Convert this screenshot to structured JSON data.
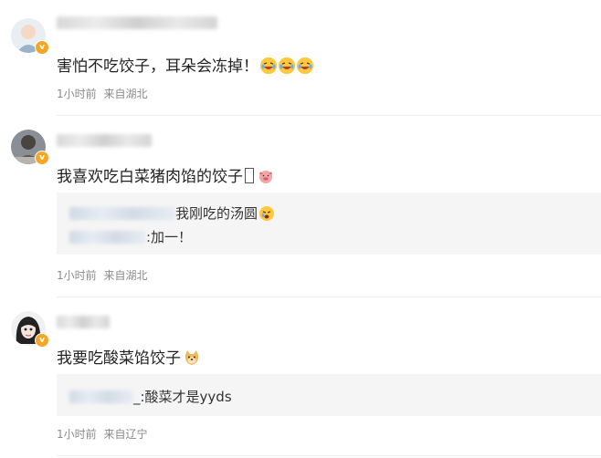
{
  "comments": [
    {
      "text": "害怕不吃饺子，耳朵会冻掉！",
      "emojis": [
        "laughing-tears-emoji",
        "laughing-tears-emoji",
        "laughing-tears-emoji"
      ],
      "time": "1小时前",
      "location": "来自湖北"
    },
    {
      "text": "我喜欢吃白菜猪肉馅的饺子",
      "emojis": [
        "box-glyph",
        "pig-emoji"
      ],
      "time": "1小时前",
      "location": "来自湖北",
      "replies": [
        {
          "text": "我刚吃的汤圆",
          "emoji": "crying-emoji"
        },
        {
          "text": ":加一！"
        }
      ]
    },
    {
      "text": "我要吃酸菜馅饺子",
      "emojis": [
        "doge-emoji"
      ],
      "time": "1小时前",
      "location": "来自辽宁",
      "replies": [
        {
          "text": "_:酸菜才是yyds"
        }
      ]
    }
  ],
  "colors": {
    "badge": "#f7a623",
    "meta_text": "#8a8a8a",
    "reply_bg": "#f5f5f5",
    "divider": "#eeeeee"
  }
}
